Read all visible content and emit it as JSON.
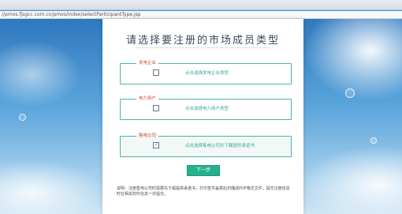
{
  "browser": {
    "url": "//pmos.fjsgcc.com.cn/pmos/index/selectParticipantType.jsp"
  },
  "page": {
    "title": "请选择要注册的市场成员类型",
    "groups": [
      {
        "legend": "发电企业",
        "option_label": "点击选择发电企业类型",
        "checked": false,
        "check_glyph": ""
      },
      {
        "legend": "电力用户",
        "option_label": "点击选择电力用户类型",
        "checked": false,
        "check_glyph": ""
      },
      {
        "legend": "售电公司",
        "option_label": "点击选择售电公司并下载提供承诺书",
        "checked": true,
        "check_glyph": "✓"
      }
    ],
    "next_button": "下一步",
    "note": "说明：注册售电公司时需要先下载提供承诺书，打印签字盖章后扫描成PDF格式文件，提交注册信息时在相关附件信息一并提交。"
  },
  "colors": {
    "accent": "#26b18e",
    "border": "#4bb3a6",
    "legend_text": "#d84a3a"
  }
}
